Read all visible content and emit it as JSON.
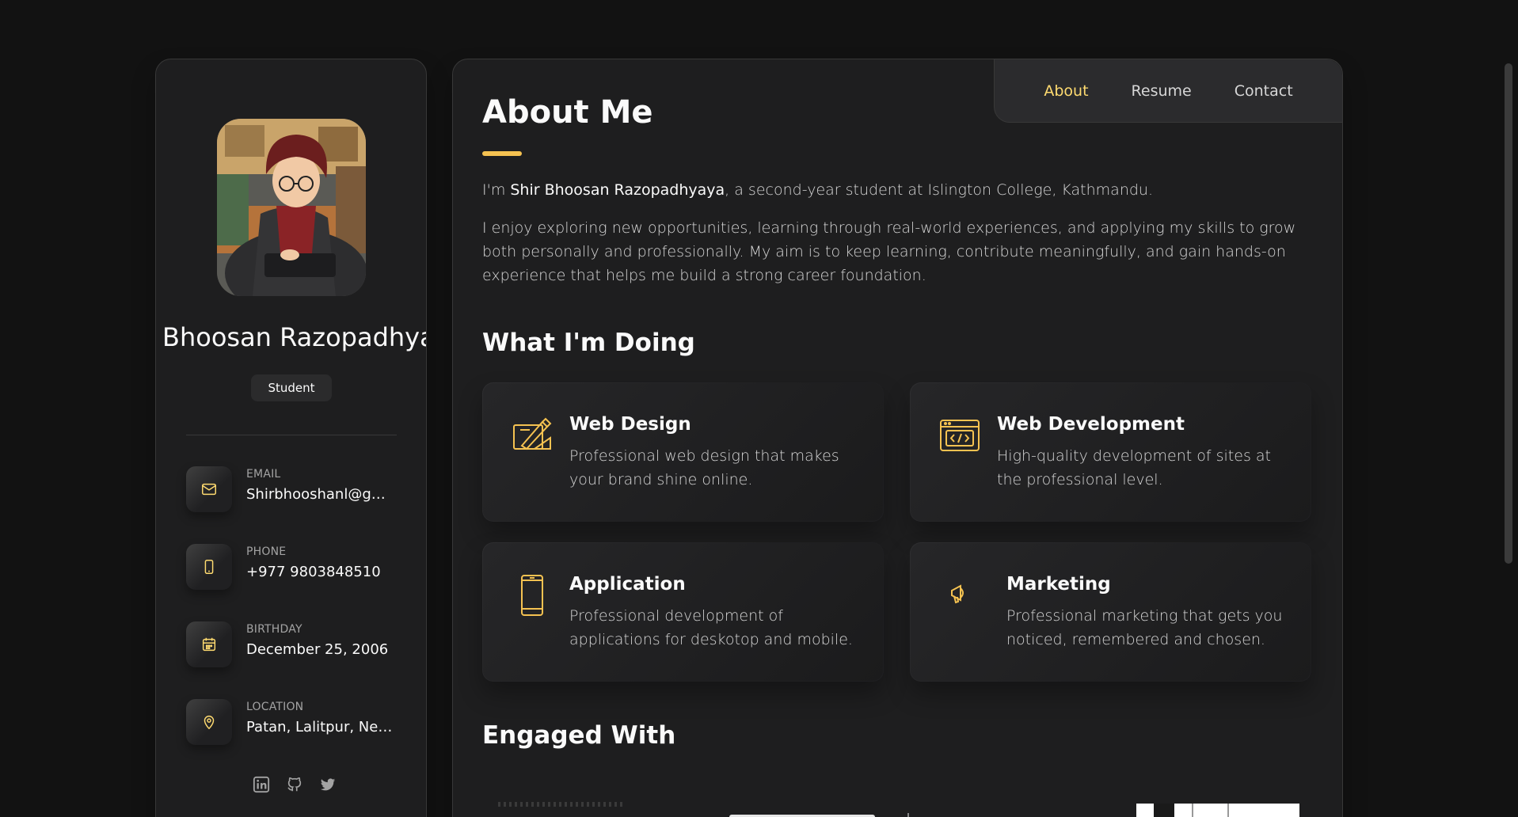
{
  "sidebar": {
    "name": "Bhoosan Razopadhyaya",
    "title": "Student",
    "contacts": [
      {
        "label": "Email",
        "value": "Shirbhooshanl@gm...",
        "icon": "mail-icon"
      },
      {
        "label": "Phone",
        "value": "+977 9803848510",
        "icon": "phone-icon"
      },
      {
        "label": "Birthday",
        "value": "December 25, 2006",
        "icon": "calendar-icon"
      },
      {
        "label": "Location",
        "value": "Patan, Lalitpur, Nepal",
        "icon": "location-icon"
      }
    ],
    "socials": [
      "linkedin-icon",
      "github-icon",
      "twitter-icon"
    ]
  },
  "navbar": {
    "items": [
      {
        "label": "About",
        "active": true
      },
      {
        "label": "Resume",
        "active": false
      },
      {
        "label": "Contact",
        "active": false
      }
    ]
  },
  "about": {
    "title": "About Me",
    "intro_prefix": "I'm ",
    "intro_name": "Shir Bhoosan Razopadhyaya",
    "intro_suffix": ", a second-year student at Islington College, Kathmandu.",
    "paragraph2": "I enjoy exploring new opportunities, learning through real-world experiences, and applying my skills to grow both personally and professionally. My aim is to keep learning, contribute meaningfully, and gain hands-on experience that helps me build a strong career foundation."
  },
  "services": {
    "heading": "What I'm Doing",
    "items": [
      {
        "title": "Web Design",
        "text": "Professional web design that makes your brand shine online.",
        "icon": "design-icon"
      },
      {
        "title": "Web Development",
        "text": "High-quality development of sites at the professional level.",
        "icon": "code-icon"
      },
      {
        "title": "Application",
        "text": "Professional development of applications for deskotop and mobile.",
        "icon": "mobile-icon"
      },
      {
        "title": "Marketing",
        "text": "Professional marketing that gets you noticed, remembered and chosen.",
        "icon": "megaphone-icon"
      }
    ]
  },
  "clients": {
    "heading": "Engaged With"
  },
  "colors": {
    "accent": "#ffdb70",
    "accent_bar": "#f5c251",
    "background": "#121212",
    "card": "#1e1e1f"
  }
}
